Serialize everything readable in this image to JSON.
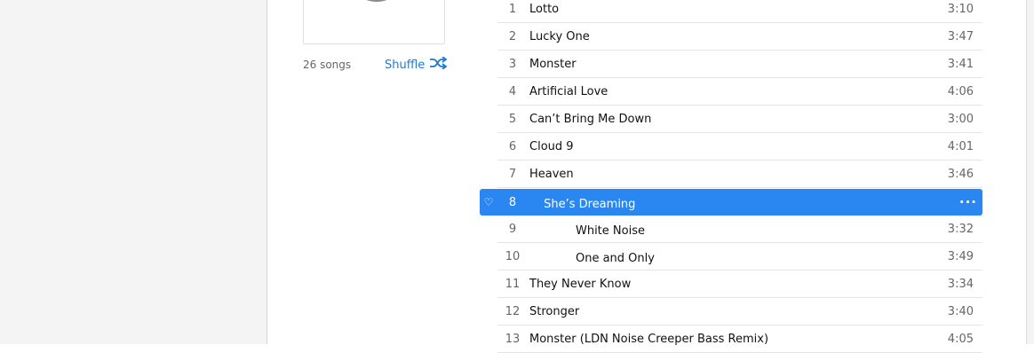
{
  "album": {
    "song_count": "26 songs",
    "shuffle_label": "Shuffle",
    "shuffle_icon": "shuffle-icon"
  },
  "selected_index": 7,
  "colors": {
    "accent": "#1e7ad6",
    "selection": "#2a87f2"
  },
  "tracks": [
    {
      "num": "1",
      "title": "Lotto",
      "time": "3:10"
    },
    {
      "num": "2",
      "title": "Lucky One",
      "time": "3:47"
    },
    {
      "num": "3",
      "title": "Monster",
      "time": "3:41"
    },
    {
      "num": "4",
      "title": "Artificial Love",
      "time": "4:06"
    },
    {
      "num": "5",
      "title": "Can’t Bring Me Down",
      "time": "3:00"
    },
    {
      "num": "6",
      "title": "Cloud 9",
      "time": "4:01"
    },
    {
      "num": "7",
      "title": "Heaven",
      "time": "3:46"
    },
    {
      "num": "8",
      "title": "ㅤ She’s Dreaming",
      "time": "",
      "heart": "♡",
      "more": "···"
    },
    {
      "num": "9",
      "title": "ㅤㅤㅤㅤ White Noise",
      "time": "3:32"
    },
    {
      "num": "10",
      "title": "ㅤㅤㅤㅤ One and Only",
      "time": "3:49"
    },
    {
      "num": "11",
      "title": "They Never Know",
      "time": "3:34"
    },
    {
      "num": "12",
      "title": "Stronger",
      "time": "3:40"
    },
    {
      "num": "13",
      "title": "Monster (LDN Noise Creeper Bass Remix)",
      "time": "4:05"
    }
  ]
}
